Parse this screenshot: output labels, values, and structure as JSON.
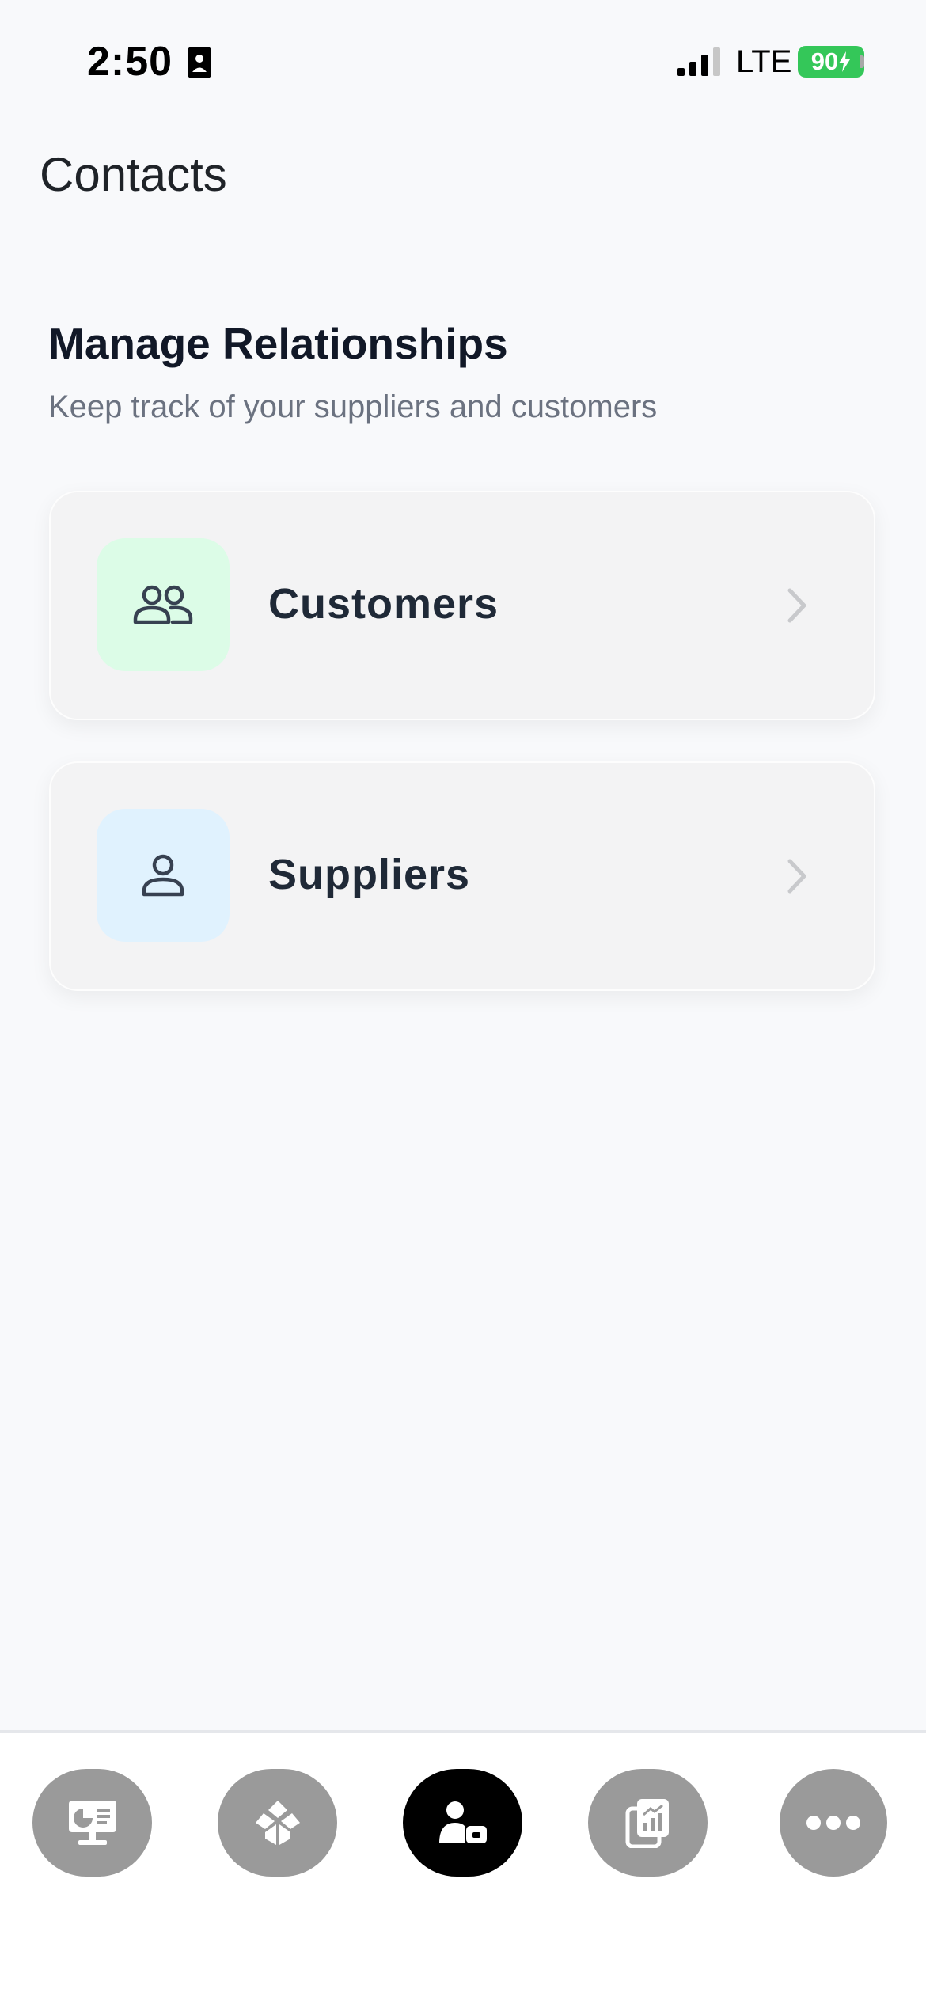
{
  "status_bar": {
    "time": "2:50",
    "network": "LTE",
    "battery": "90"
  },
  "header": {
    "title": "Contacts"
  },
  "section": {
    "title": "Manage Relationships",
    "subtitle": "Keep track of your suppliers and customers"
  },
  "cards": [
    {
      "label": "Customers",
      "icon": "users-icon",
      "icon_bg": "#dcfce7"
    },
    {
      "label": "Suppliers",
      "icon": "user-icon",
      "icon_bg": "#e0f2fe"
    }
  ],
  "bottom_nav": {
    "items": [
      {
        "icon": "dashboard-icon",
        "active": false
      },
      {
        "icon": "inventory-icon",
        "active": false
      },
      {
        "icon": "contacts-icon",
        "active": true
      },
      {
        "icon": "reports-icon",
        "active": false
      },
      {
        "icon": "more-icon",
        "active": false
      }
    ],
    "active_color": "#000000",
    "inactive_color": "#9a9a9a"
  }
}
